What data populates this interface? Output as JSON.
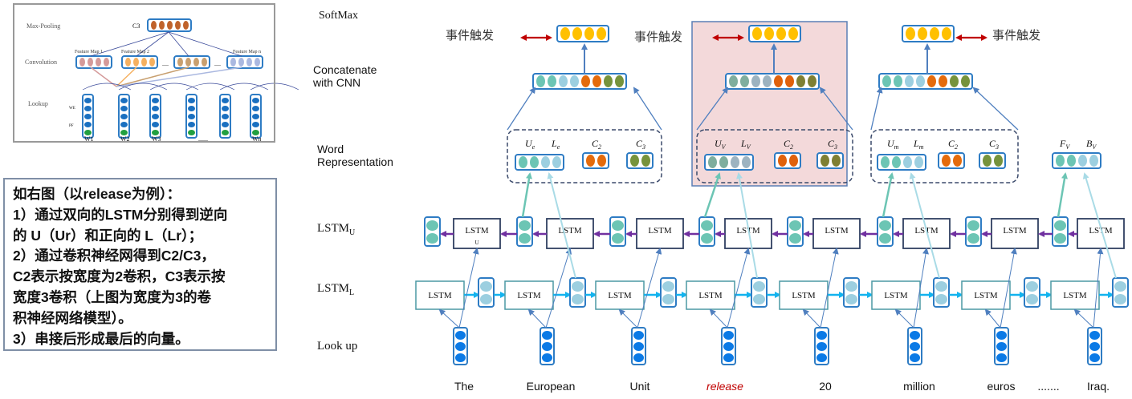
{
  "inset": {
    "layers": [
      "Max-Pooling",
      "Convolution",
      "Lookup"
    ],
    "pool_label": "C3",
    "feature_maps": [
      "Feature Map 1",
      "Feature Map 2",
      "Feature Map n"
    ],
    "lookup_side_labels": [
      "WE",
      "PF"
    ],
    "words": [
      "W1",
      "W2",
      "W3",
      "......",
      "Wn"
    ],
    "ellipsis": "...."
  },
  "note": {
    "lines": [
      "如右图（以release为例）：",
      "1）通过双向的LSTM分别得到逆向",
      "的 U（Ur）和正向的 L（Lr）；",
      "2）通过卷积神经网得到C2/C3，",
      "C2表示按宽度为2卷积，C3表示按",
      "宽度3卷积（上图为宽度为3的卷",
      "积神经网络模型）。",
      "3）串接后形成最后的向量。"
    ]
  },
  "layers": {
    "softmax": "SoftMax",
    "concat_1": "Concatenate",
    "concat_2": "with CNN",
    "wordrep_1": "Word",
    "wordrep_2": "Representation",
    "lstm_u": "LSTM",
    "lstm_u_sub": "U",
    "lstm_l": "LSTM",
    "lstm_l_sub": "L",
    "lookup": "Look up"
  },
  "trigger_label": "事件触发",
  "lstm_cell": "LSTM",
  "lstm_cell_sub": "U",
  "groups": [
    {
      "u": "U",
      "u_sub": "e",
      "l": "L",
      "l_sub": "e",
      "c2": "C2",
      "c3": "C3"
    },
    {
      "u": "U",
      "u_sub": "V",
      "l": "L",
      "l_sub": "V",
      "c2": "C2",
      "c3": "C3"
    },
    {
      "u": "U",
      "u_sub": "m",
      "l": "L",
      "l_sub": "m",
      "c2": "C2",
      "c3": "C3"
    }
  ],
  "final_rep": {
    "f": "F",
    "f_sub": "V",
    "b": "B",
    "b_sub": "V"
  },
  "words": [
    "The",
    "European",
    "Unit",
    "release",
    "20",
    "million",
    "euros",
    ".......",
    "Iraq."
  ],
  "highlight_word_index": 3,
  "colors": {
    "teal": "#6cc5b4",
    "lightblue": "#9ccfe0",
    "orange": "#e46b0c",
    "green": "#76933c",
    "yellow": "#ffc000",
    "border": "#2e7cc4",
    "lookup": "#0b7ae6",
    "highlight": "#f3d9da",
    "purple": "#7030a0",
    "cyan": "#12b3ee",
    "red": "#c00000"
  }
}
